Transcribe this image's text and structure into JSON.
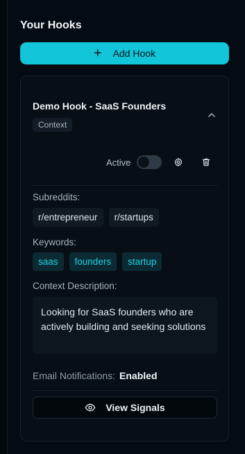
{
  "section": {
    "title": "Your Hooks"
  },
  "add_button": {
    "label": "Add Hook",
    "icon": "plus-icon"
  },
  "hook": {
    "title": "Demo Hook - SaaS Founders",
    "tag": "Context",
    "expanded": true,
    "active_label": "Active",
    "active": false,
    "subreddits_label": "Subreddits:",
    "subreddits": [
      "r/entrepreneur",
      "r/startups"
    ],
    "keywords_label": "Keywords:",
    "keywords": [
      "saas",
      "founders",
      "startup"
    ],
    "context_label": "Context Description:",
    "context_text": "Looking for SaaS founders who are actively building and seeking solutions",
    "email_label": "Email Notifications:",
    "email_value": "Enabled",
    "view_signals_label": "View Signals"
  },
  "colors": {
    "accent": "#13c5d8",
    "keyword_text": "#1fd2e4",
    "background": "#03080d"
  }
}
